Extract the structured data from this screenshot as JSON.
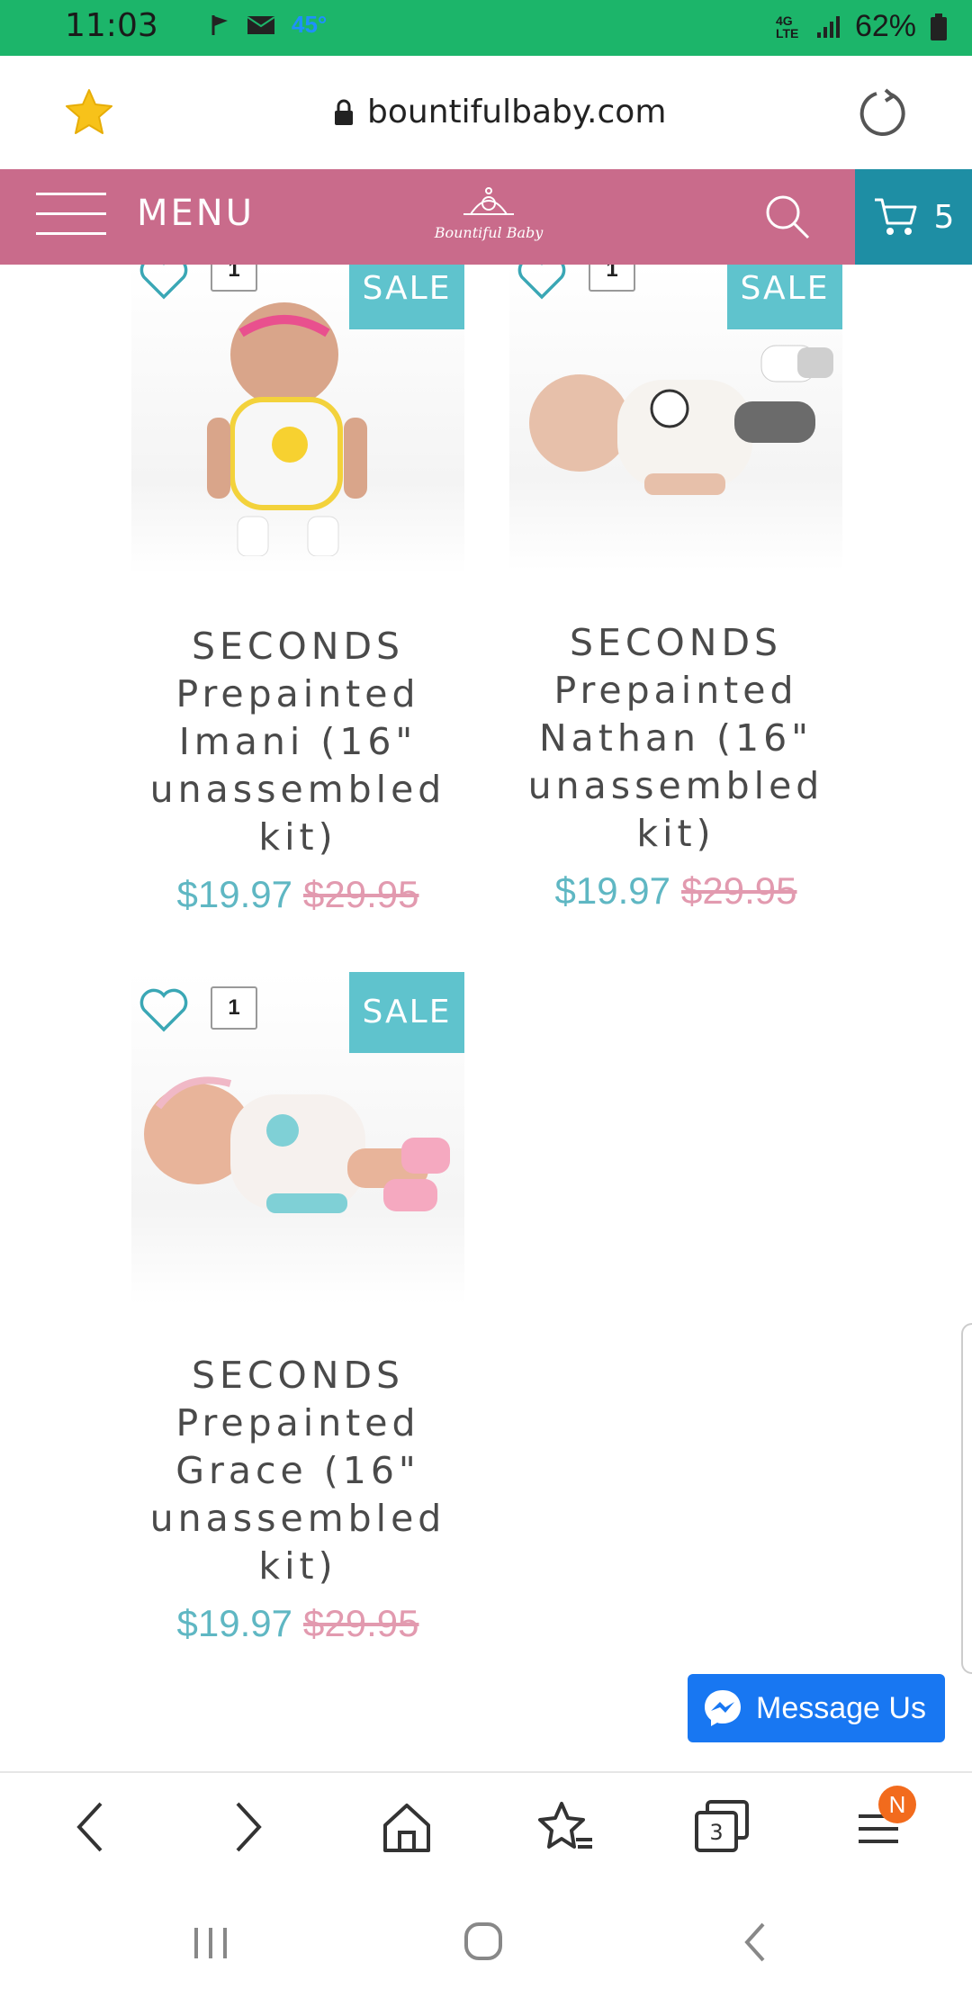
{
  "status_bar": {
    "time": "11:03",
    "temperature": "45°",
    "network": "4G LTE",
    "battery": "62%",
    "icons": [
      "flag-icon",
      "mail-icon",
      "signal-icon",
      "battery-icon"
    ]
  },
  "browser": {
    "url": "bountifulbaby.com",
    "icons": [
      "star-icon",
      "lock-icon",
      "reload-icon"
    ]
  },
  "header": {
    "menu_label": "MENU",
    "logo_text": "Bountiful Baby",
    "cart_count": "5"
  },
  "products": [
    {
      "title_lines": [
        "SECONDS",
        "Prepainted",
        "Imani (16\"",
        "unassembled",
        "kit)"
      ],
      "price": "$19.97",
      "old_price": "$29.95",
      "badge": "SALE",
      "qty": "1"
    },
    {
      "title_lines": [
        "SECONDS",
        "Prepainted",
        "Nathan (16\"",
        "unassembled",
        "kit)"
      ],
      "price": "$19.97",
      "old_price": "$29.95",
      "badge": "SALE",
      "qty": "1"
    },
    {
      "title_lines": [
        "SECONDS",
        "Prepainted",
        "Grace (16\"",
        "unassembled",
        "kit)"
      ],
      "price": "$19.97",
      "old_price": "$29.95",
      "badge": "SALE",
      "qty": "1"
    }
  ],
  "messenger": {
    "label": "Message Us"
  },
  "bottom_nav": {
    "tabs_count": "3",
    "menu_badge": "N"
  },
  "colors": {
    "status_green": "#1cb56a",
    "header_pink": "#c96b8b",
    "cart_teal": "#1e8ea4",
    "sale_teal": "#5fc3cd",
    "price_teal": "#5fb7c3",
    "old_price_pink": "#e29aaf",
    "messenger_blue": "#1877f2"
  }
}
